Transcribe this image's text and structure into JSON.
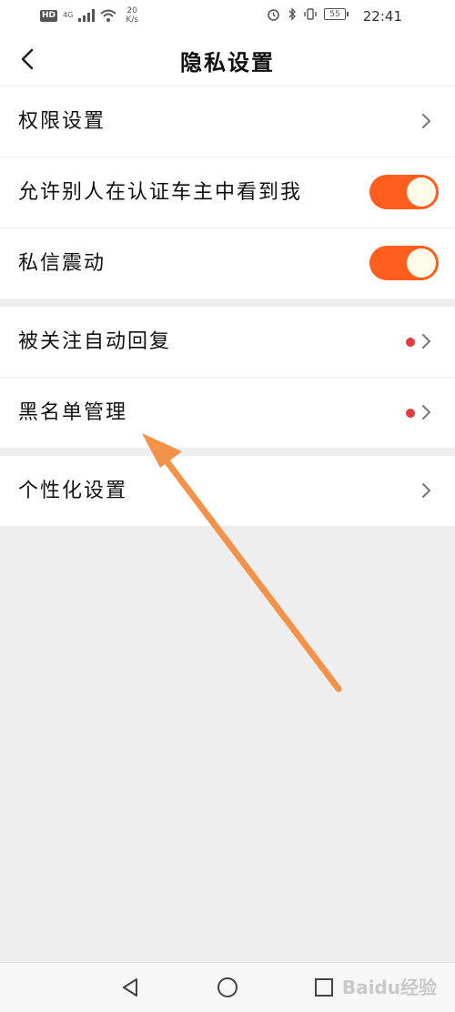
{
  "status_bar": {
    "hd_badge": "HD",
    "network_type": "4G",
    "network_speed_value": "20",
    "network_speed_unit": "K/s",
    "battery_level": "55",
    "time": "22:41"
  },
  "header": {
    "title": "隐私设置",
    "back_icon": "chevron-left-icon"
  },
  "groups": [
    {
      "items": [
        {
          "label": "权限设置",
          "control": "chevron"
        },
        {
          "label": "允许别人在认证车主中看到我",
          "control": "toggle",
          "on": true
        },
        {
          "label": "私信震动",
          "control": "toggle",
          "on": true
        }
      ]
    },
    {
      "items": [
        {
          "label": "被关注自动回复",
          "control": "chevron",
          "red_dot": true
        },
        {
          "label": "黑名单管理",
          "control": "chevron",
          "red_dot": true
        }
      ]
    },
    {
      "items": [
        {
          "label": "个性化设置",
          "control": "chevron"
        }
      ]
    }
  ],
  "nav_bar": {
    "back_icon": "triangle-back-icon",
    "home_icon": "circle-home-icon",
    "recent_icon": "square-recent-icon"
  },
  "watermark": "Baidu经验",
  "colors": {
    "toggle_on": "#ff5e1f",
    "toggle_knob": "#fffbe9",
    "red_dot": "#e33b3b",
    "arrow": "#f5924a",
    "background": "#eeeeee"
  }
}
